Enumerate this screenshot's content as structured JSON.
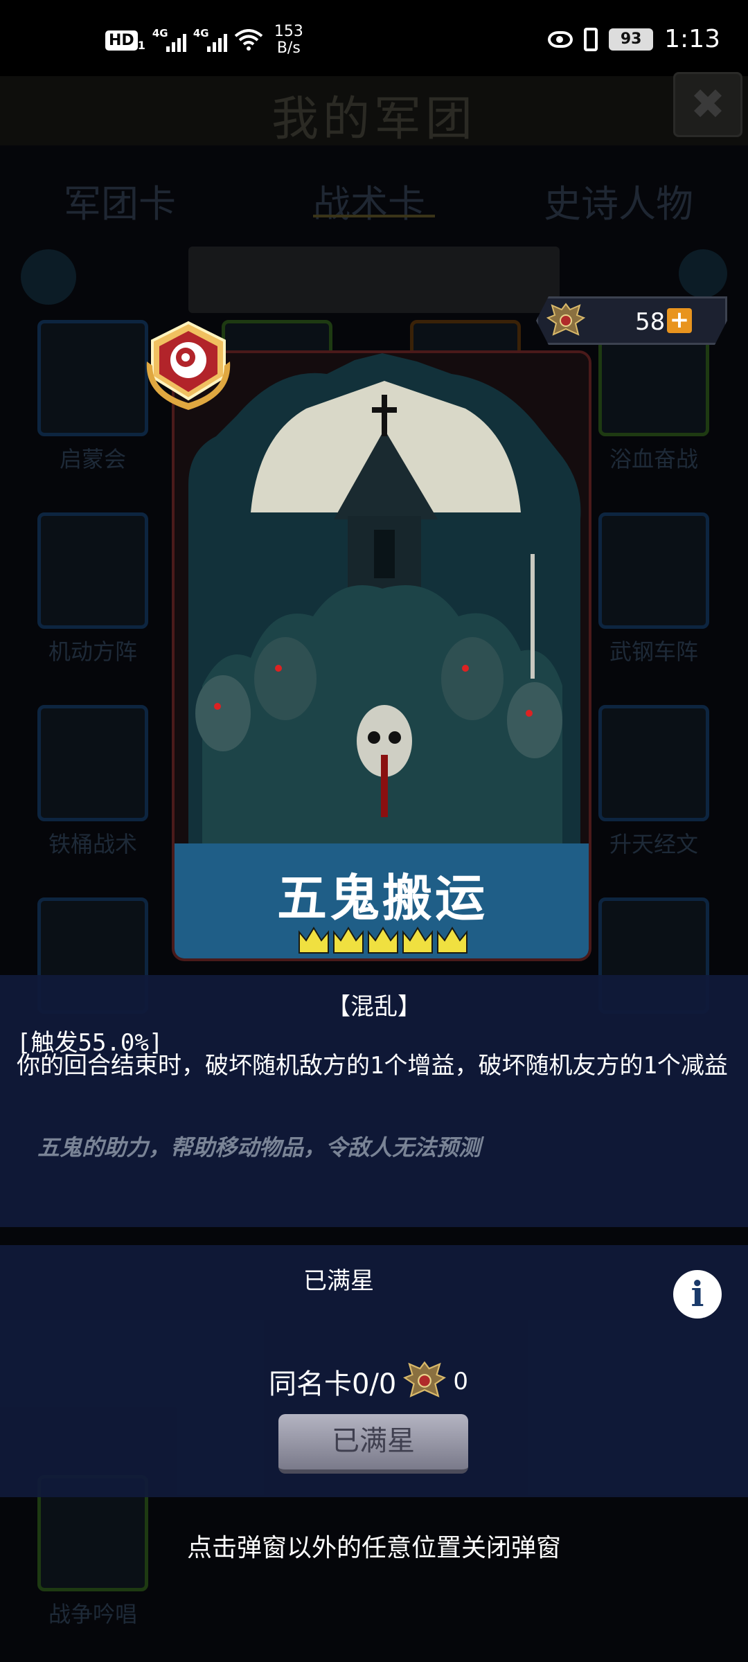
{
  "status_bar": {
    "hd": "HD",
    "sim": "1",
    "net1": "4G",
    "net2": "4G",
    "speed_value": "153",
    "speed_unit": "B/s",
    "battery": "93",
    "time": "1:13"
  },
  "background": {
    "title": "我的军团",
    "tabs": [
      "军团卡",
      "战术卡",
      "史诗人物"
    ],
    "cards": [
      "启蒙会",
      "浴血奋战",
      "机动方阵",
      "武钢车阵",
      "铁桶战术",
      "升天经文",
      "五鬼搬运",
      "战争吟唱"
    ]
  },
  "currency": {
    "value": "58",
    "plus": "+"
  },
  "card": {
    "name": "五鬼搬运",
    "stars": 5
  },
  "description": {
    "tag": "【混乱】",
    "trigger": "[触发55.0%]",
    "effect": "你的回合结束时，破坏随机敌方的1个增益，破坏随机友方的1个减益",
    "flavor": "五鬼的助力，帮助移动物品，令敌人无法预测"
  },
  "star_panel": {
    "status": "已满星",
    "info": "i",
    "dup_label": "同名卡0/0",
    "dup_currency": "0",
    "button": "已满星"
  },
  "hint": "点击弹窗以外的任意位置关闭弹窗",
  "colors": {
    "panel": "#101a3a",
    "card_band": "#1f5e87",
    "crown": "#f0e040",
    "plus": "#e8941e"
  }
}
